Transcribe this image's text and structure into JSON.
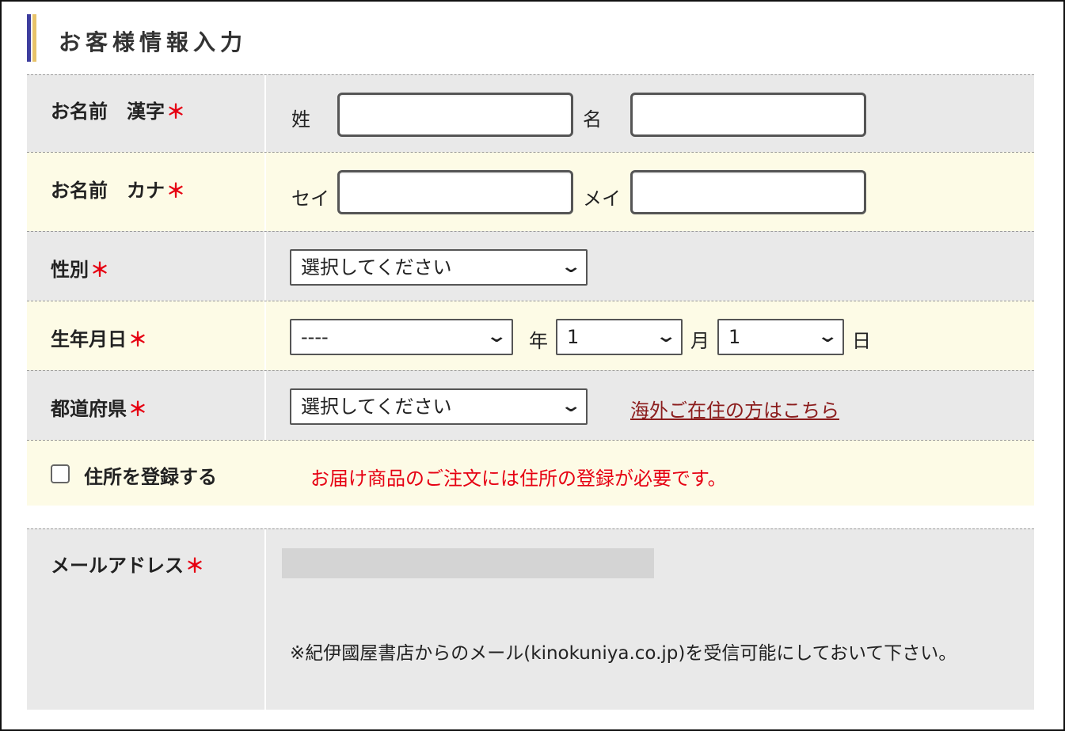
{
  "section": {
    "title": "お客様情報入力"
  },
  "required_mark": "＊",
  "rows": {
    "name_kanji": {
      "label": "お名前　漢字",
      "last_label": "姓",
      "first_label": "名",
      "last_value": "",
      "first_value": ""
    },
    "name_kana": {
      "label": "お名前　カナ",
      "last_label": "セイ",
      "first_label": "メイ",
      "last_value": "",
      "first_value": ""
    },
    "gender": {
      "label": "性別",
      "selected": "選択してください"
    },
    "birthday": {
      "label": "生年月日",
      "year_selected": "----",
      "year_suffix": "年",
      "month_selected": "1",
      "month_suffix": "月",
      "day_selected": "1",
      "day_suffix": "日"
    },
    "prefecture": {
      "label": "都道府県",
      "selected": "選択してください",
      "overseas_link": "海外ご在住の方はこちら"
    },
    "address": {
      "checkbox_label": "住所を登録する",
      "checked": false,
      "notice": "お届け商品のご注文には住所の登録が必要です。"
    },
    "email": {
      "label": "メールアドレス",
      "note": "※紀伊國屋書店からのメール(kinokuniya.co.jp)を受信可能にしておいて下さい。"
    }
  },
  "colors": {
    "row_gray": "#e9e9e9",
    "row_cream": "#fdfbe6",
    "required": "#e60012",
    "link": "#8b1c1c",
    "notice": "#e60012"
  }
}
